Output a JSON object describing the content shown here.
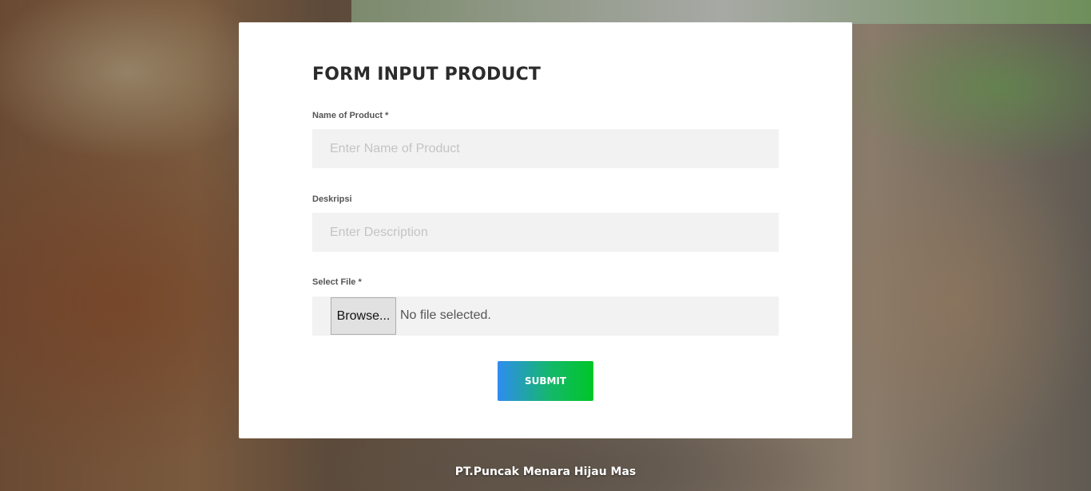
{
  "form": {
    "title": "FORM INPUT PRODUCT",
    "fields": {
      "name": {
        "label": "Name of Product *",
        "placeholder": "Enter Name of Product",
        "value": ""
      },
      "description": {
        "label": "Deskripsi",
        "placeholder": "Enter Description",
        "value": ""
      },
      "file": {
        "label": "Select File *",
        "browse_label": "Browse...",
        "status": "No file selected."
      }
    },
    "submit_label": "SUBMIT"
  },
  "footer": {
    "company": "PT.Puncak Menara Hijau Mas"
  },
  "colors": {
    "submit_gradient_start": "#2f8cf0",
    "submit_gradient_end": "#00c627",
    "input_background": "#f2f2f2"
  }
}
